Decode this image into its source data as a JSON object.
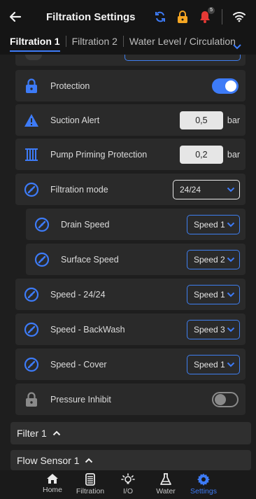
{
  "header": {
    "title": "Filtration Settings",
    "notification_count": "5",
    "icons": [
      "arrow-left-icon",
      "sync-icon",
      "lock-icon",
      "bell-icon",
      "wifi-icon"
    ]
  },
  "tabs": [
    {
      "label": "Filtration 1",
      "active": true
    },
    {
      "label": "Filtration 2",
      "active": false
    },
    {
      "label": "Water Level / Circulation",
      "active": false
    }
  ],
  "settings": {
    "protection": {
      "label": "Protection",
      "enabled": true
    },
    "suction_alert": {
      "label": "Suction Alert",
      "value": "0,5",
      "unit": "bar"
    },
    "pump_priming": {
      "label": "Pump Priming Protection",
      "value": "0,2",
      "unit": "bar"
    },
    "filtration_mode": {
      "label": "Filtration mode",
      "value": "24/24"
    },
    "drain_speed": {
      "label": "Drain Speed",
      "value": "Speed 1"
    },
    "surface_speed": {
      "label": "Surface Speed",
      "value": "Speed 2"
    },
    "speed_2424": {
      "label": "Speed - 24/24",
      "value": "Speed 1"
    },
    "speed_backwash": {
      "label": "Speed - BackWash",
      "value": "Speed 3"
    },
    "speed_cover": {
      "label": "Speed - Cover",
      "value": "Speed 1"
    },
    "pressure_inhibit": {
      "label": "Pressure Inhibit",
      "enabled": false
    }
  },
  "sections": {
    "filter1": "Filter 1",
    "flow_sensor1": "Flow Sensor 1"
  },
  "nav": [
    {
      "label": "Home",
      "icon": "home-icon"
    },
    {
      "label": "Filtration",
      "icon": "filter-icon"
    },
    {
      "label": "I/O",
      "icon": "bulb-icon"
    },
    {
      "label": "Water",
      "icon": "flask-icon"
    },
    {
      "label": "Settings",
      "icon": "gear-icon",
      "active": true
    }
  ],
  "colors": {
    "accent": "#3d7bf7",
    "background": "#1e1e1e",
    "card": "#2a2a2a",
    "lock": "#f5a623",
    "bell": "#e53935"
  }
}
